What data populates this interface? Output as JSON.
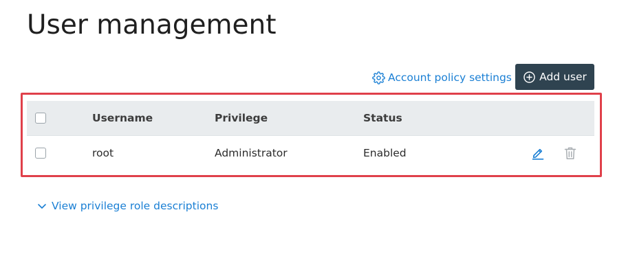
{
  "page": {
    "title": "User management"
  },
  "toolbar": {
    "account_policy_label": "Account policy settings",
    "account_policy_icon": "gear-icon",
    "add_user_label": "Add user",
    "add_user_icon": "plus-circle-icon"
  },
  "table": {
    "columns": [
      "Username",
      "Privilege",
      "Status"
    ],
    "rows": [
      {
        "username": "root",
        "privilege": "Administrator",
        "status": "Enabled",
        "actions": [
          "edit-icon",
          "trash-icon"
        ]
      }
    ]
  },
  "footer": {
    "view_roles_label": "View privilege role descriptions",
    "view_roles_icon": "chevron-down-icon"
  },
  "colors": {
    "link": "#1a7fd4",
    "primary_button": "#2f4350",
    "header_bg": "#e9ecee",
    "highlight": "#e0404a"
  }
}
